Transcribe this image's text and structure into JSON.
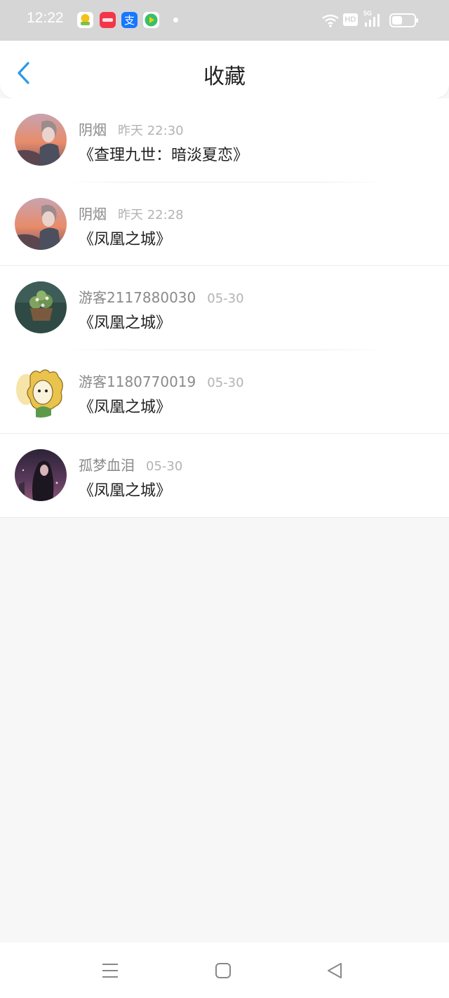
{
  "status_bar": {
    "time": "12:22",
    "app_icons": [
      "weather-app-icon",
      "shopping-app-icon",
      "alipay-app-icon",
      "video-app-icon"
    ],
    "alipay_glyph": "支",
    "system_icons": [
      "wifi-icon",
      "hd-icon",
      "5g-signal-icon",
      "battery-icon"
    ],
    "hd_label": "HD",
    "network_label": "5G"
  },
  "header": {
    "title": "收藏",
    "back_icon": "chevron-left-icon",
    "accent_color": "#2a9ae6"
  },
  "favorites": [
    {
      "username": "阴烟",
      "time": "昨天 22:30",
      "title": "《查理九世：暗淡夏恋》",
      "avatar": "anime-boy-sunset-avatar"
    },
    {
      "username": "阴烟",
      "time": "昨天 22:28",
      "title": "《凤凰之城》",
      "avatar": "anime-boy-sunset-avatar"
    },
    {
      "username": "游客2117880030",
      "time": "05-30",
      "title": "《凤凰之城》",
      "avatar": "flower-pot-avatar"
    },
    {
      "username": "游客1180770019",
      "time": "05-30",
      "title": "《凤凰之城》",
      "avatar": "cartoon-girl-avatar"
    },
    {
      "username": "孤梦血泪",
      "time": "05-30",
      "title": "《凤凰之城》",
      "avatar": "dark-anime-girl-avatar"
    }
  ],
  "nav_bar": {
    "buttons": [
      "menu-icon",
      "home-icon",
      "back-triangle-icon"
    ]
  }
}
